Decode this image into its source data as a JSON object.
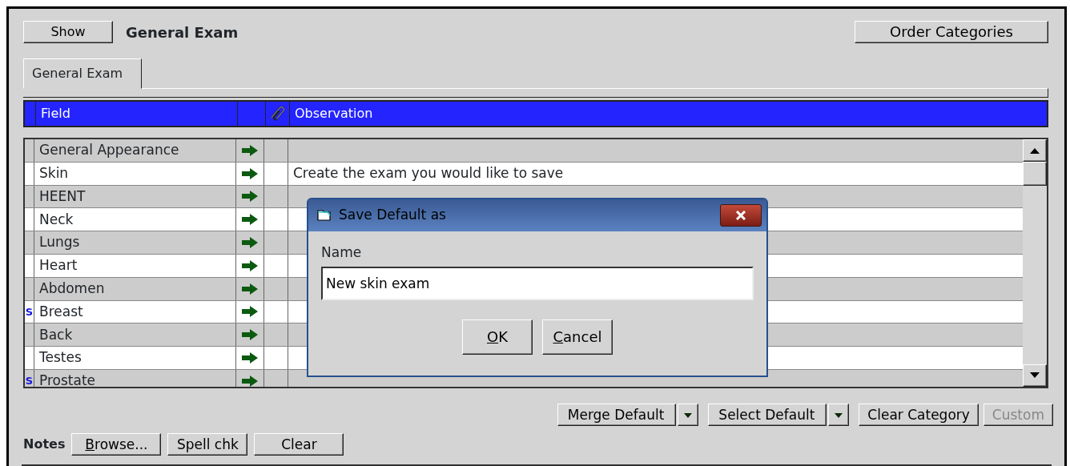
{
  "toolbar": {
    "show_button": "Show",
    "title": "General Exam",
    "order_button": "Order Categories"
  },
  "tabs": [
    {
      "label": "General Exam",
      "selected": true
    }
  ],
  "grid": {
    "columns": [
      {
        "label": "Field"
      },
      {},
      {
        "label": "Observation"
      }
    ],
    "rows": [
      {
        "marker": "",
        "field": "General Appearance",
        "observation": ""
      },
      {
        "marker": "",
        "field": "Skin",
        "observation": "Create the exam you would like to save"
      },
      {
        "marker": "",
        "field": "HEENT",
        "observation": ""
      },
      {
        "marker": "",
        "field": "Neck",
        "observation": ""
      },
      {
        "marker": "",
        "field": "Lungs",
        "observation": ""
      },
      {
        "marker": "",
        "field": "Heart",
        "observation": ""
      },
      {
        "marker": "",
        "field": "Abdomen",
        "observation": ""
      },
      {
        "marker": "S",
        "field": "Breast",
        "observation": ""
      },
      {
        "marker": "",
        "field": "Back",
        "observation": ""
      },
      {
        "marker": "",
        "field": "Testes",
        "observation": ""
      },
      {
        "marker": "S",
        "field": "Prostate",
        "observation": ""
      }
    ]
  },
  "dialog": {
    "title": "Save Default as",
    "label": "Name",
    "value": "New skin exam",
    "buttons": [
      {
        "label": "OK",
        "underline_first": true
      },
      {
        "label": "Cancel",
        "underline_first": true
      }
    ]
  },
  "actions": [
    {
      "label": "Merge Default",
      "dropdown": true,
      "disabled": false
    },
    {
      "label": "Select Default",
      "dropdown": true,
      "disabled": false
    },
    {
      "label": "Clear Category",
      "dropdown": false,
      "disabled": false
    },
    {
      "label": "Custom",
      "dropdown": false,
      "disabled": true
    }
  ],
  "notes": {
    "label": "Notes",
    "buttons": [
      {
        "label": "Browse...",
        "underline_first": true
      },
      {
        "label": "Spell chk",
        "underline_first": false
      },
      {
        "label": "Clear",
        "underline_first": false
      }
    ]
  }
}
